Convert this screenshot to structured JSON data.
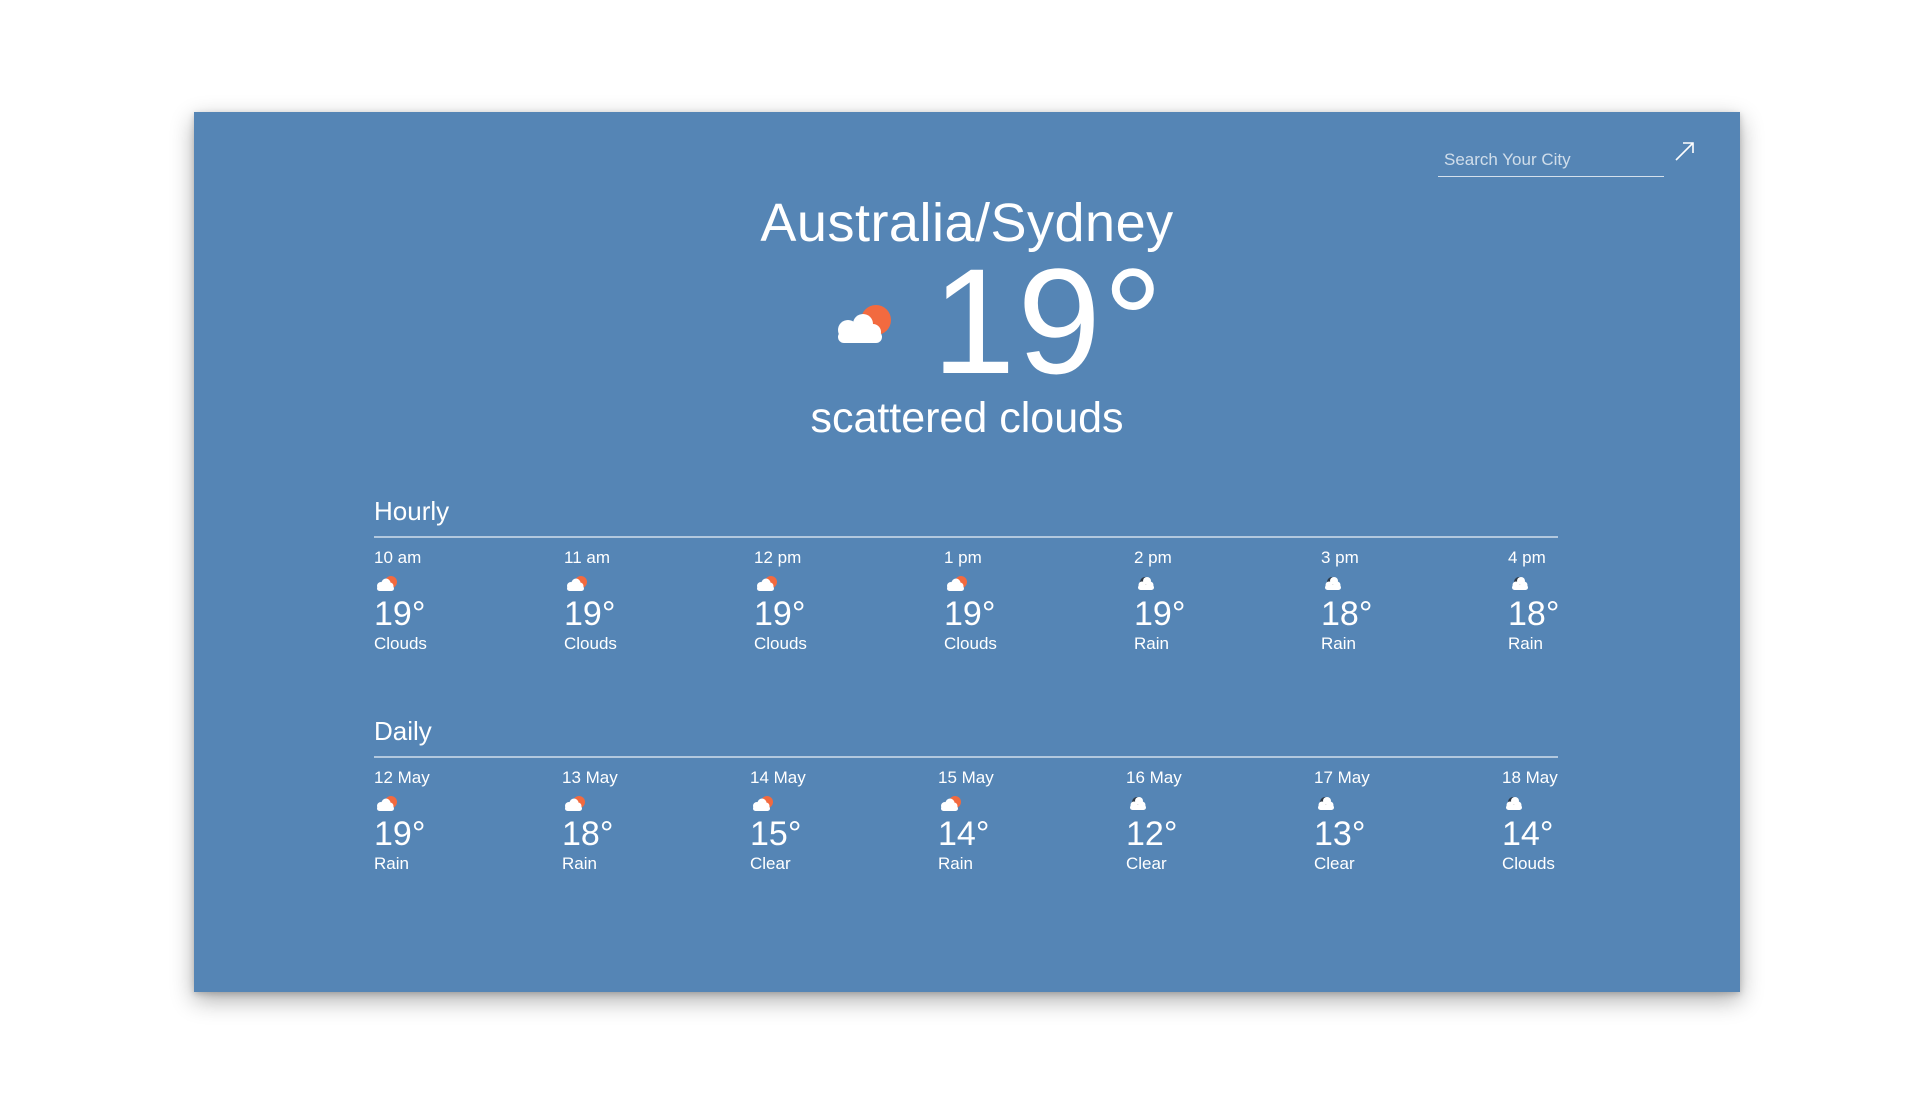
{
  "search": {
    "placeholder": "Search Your City",
    "value": ""
  },
  "current": {
    "city": "Australia/Sydney",
    "temp": "19°",
    "description": "scattered clouds",
    "icon": "partly-cloudy-day-icon"
  },
  "hourly": {
    "title": "Hourly",
    "items": [
      {
        "time": "10 am",
        "temp": "19°",
        "cond": "Clouds",
        "icon": "partly-cloudy-day-icon"
      },
      {
        "time": "11 am",
        "temp": "19°",
        "cond": "Clouds",
        "icon": "partly-cloudy-day-icon"
      },
      {
        "time": "12 pm",
        "temp": "19°",
        "cond": "Clouds",
        "icon": "partly-cloudy-day-icon"
      },
      {
        "time": "1 pm",
        "temp": "19°",
        "cond": "Clouds",
        "icon": "partly-cloudy-day-icon"
      },
      {
        "time": "2 pm",
        "temp": "19°",
        "cond": "Rain",
        "icon": "cloudy-night-icon"
      },
      {
        "time": "3 pm",
        "temp": "18°",
        "cond": "Rain",
        "icon": "cloudy-night-icon"
      },
      {
        "time": "4 pm",
        "temp": "18°",
        "cond": "Rain",
        "icon": "cloudy-night-icon"
      }
    ]
  },
  "daily": {
    "title": "Daily",
    "items": [
      {
        "time": "12 May",
        "temp": "19°",
        "cond": "Rain",
        "icon": "partly-cloudy-day-icon"
      },
      {
        "time": "13 May",
        "temp": "18°",
        "cond": "Rain",
        "icon": "partly-cloudy-day-icon"
      },
      {
        "time": "14 May",
        "temp": "15°",
        "cond": "Clear",
        "icon": "partly-cloudy-day-icon"
      },
      {
        "time": "15 May",
        "temp": "14°",
        "cond": "Rain",
        "icon": "partly-cloudy-day-icon"
      },
      {
        "time": "16 May",
        "temp": "12°",
        "cond": "Clear",
        "icon": "cloudy-night-icon"
      },
      {
        "time": "17 May",
        "temp": "13°",
        "cond": "Clear",
        "icon": "cloudy-night-icon"
      },
      {
        "time": "18 May",
        "temp": "14°",
        "cond": "Clouds",
        "icon": "cloudy-night-icon"
      }
    ]
  },
  "colors": {
    "background": "#5585b5",
    "sun": "#f26a3f",
    "cloud": "#ffffff",
    "moon": "#2f3a47",
    "text": "#ffffff"
  }
}
